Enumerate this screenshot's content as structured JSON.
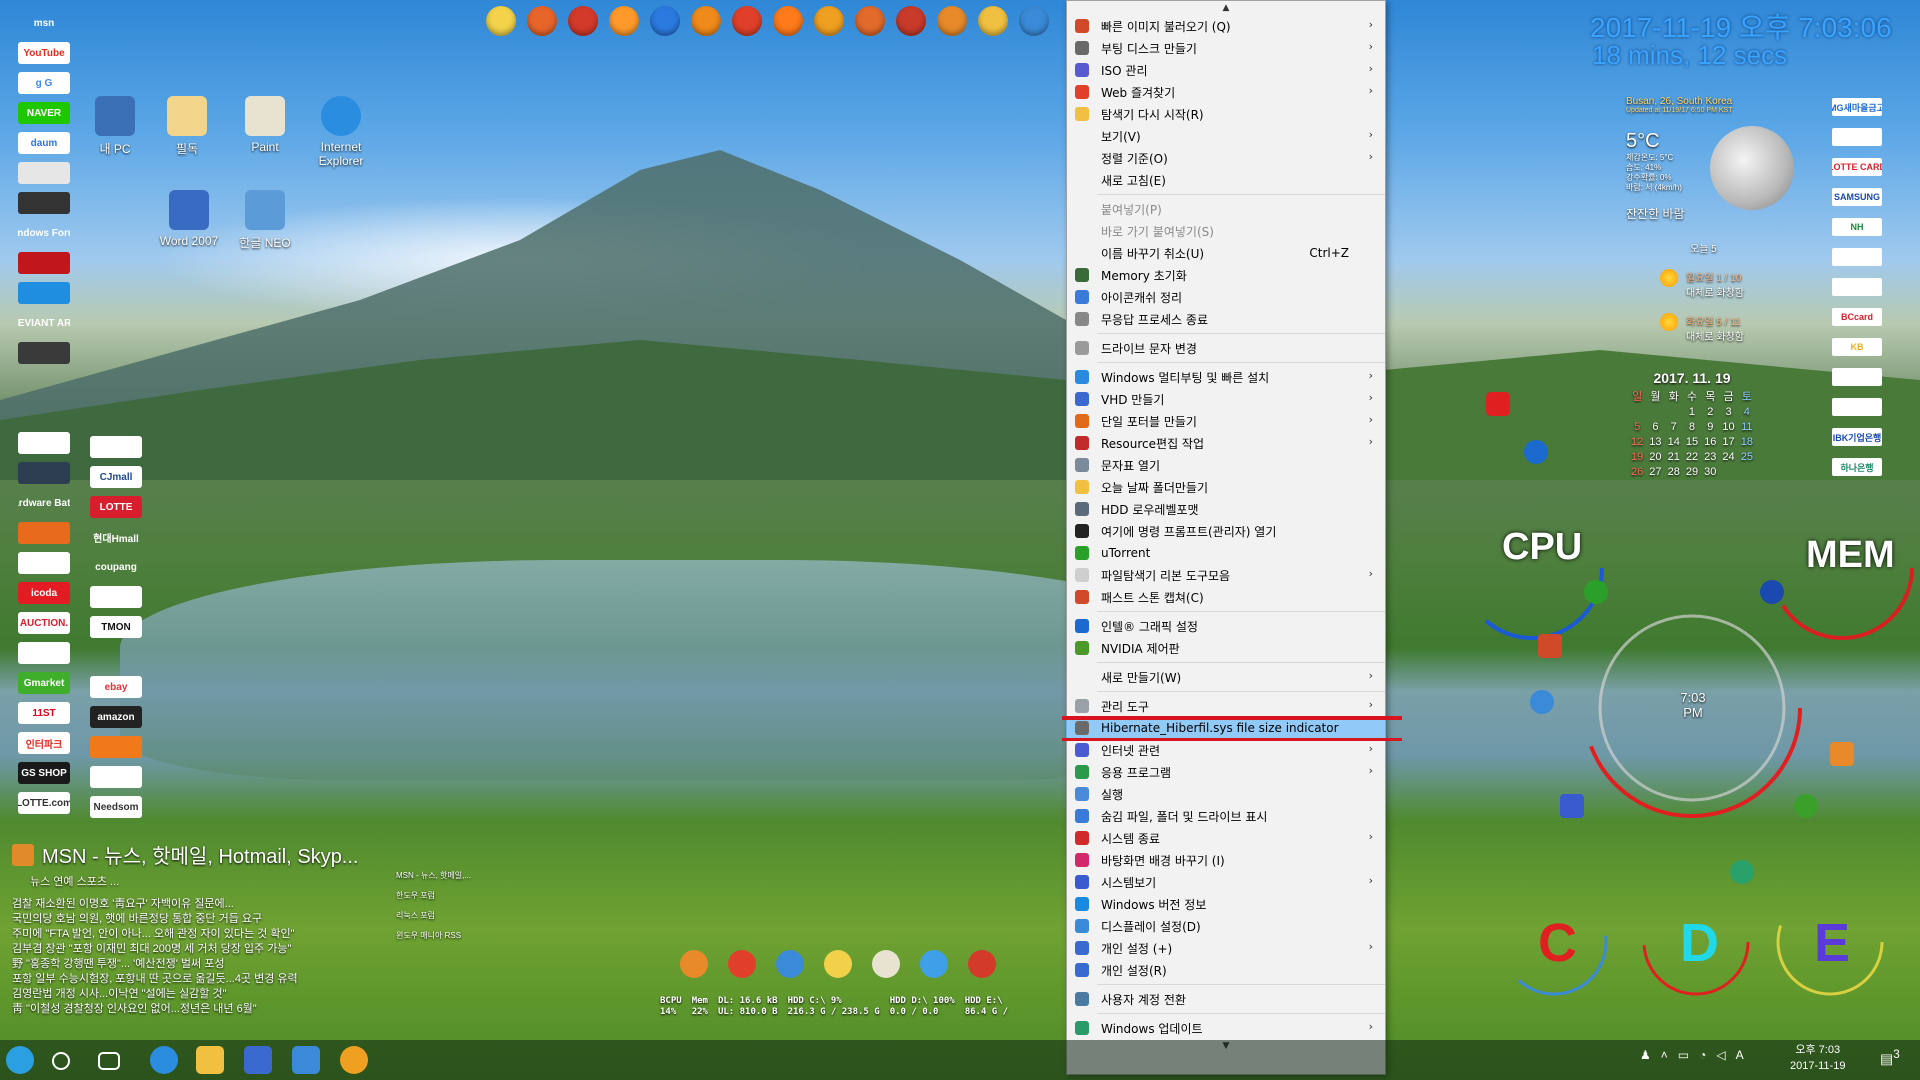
{
  "desktop": {
    "icons": [
      {
        "label": "내 PC",
        "color": "#3b6fb6"
      },
      {
        "label": "필독",
        "color": "#f2d48a"
      },
      {
        "label": "Paint",
        "color": "#e8e3d0"
      },
      {
        "label": "Internet Explorer",
        "color": "#2a8de0"
      },
      {
        "label": "Word 2007",
        "color": "#3a6bc2"
      },
      {
        "label": "한글 NEO",
        "color": "#5a9bd8"
      }
    ],
    "left_links": [
      {
        "label": "msn",
        "bg": "transparent",
        "fg": "#ffffff"
      },
      {
        "label": "YouTube",
        "bg": "#ffffff",
        "fg": "#e02b20"
      },
      {
        "label": "g G",
        "bg": "#ffffff",
        "fg": "#4285f4"
      },
      {
        "label": "NAVER",
        "bg": "#1ec800",
        "fg": "#ffffff"
      },
      {
        "label": "daum",
        "bg": "#ffffff",
        "fg": "#2d77e3"
      },
      {
        "label": "",
        "bg": "#e6e6e6",
        "fg": "#333333"
      },
      {
        "label": "",
        "bg": "#333333",
        "fg": "#ffffff"
      },
      {
        "label": "Windows Forum",
        "bg": "transparent",
        "fg": "#ffffff"
      },
      {
        "label": "",
        "bg": "#c0161c",
        "fg": "#ffffff"
      },
      {
        "label": "",
        "bg": "#1f8ee0",
        "fg": "#ffffff"
      },
      {
        "label": "DEVIANT ART",
        "bg": "transparent",
        "fg": "#ffffff"
      },
      {
        "label": "",
        "bg": "#3a3a3a",
        "fg": "#ffffff"
      },
      {
        "label": "",
        "bg": "transparent",
        "fg": "#ffffff"
      },
      {
        "label": "",
        "bg": "transparent",
        "fg": "#ffffff"
      },
      {
        "label": "",
        "bg": "#ffffff",
        "fg": "#c81e1e"
      },
      {
        "label": "",
        "bg": "#2c3e50",
        "fg": "#ffffff"
      },
      {
        "label": "Hardware Battle",
        "bg": "transparent",
        "fg": "#ffffff"
      },
      {
        "label": "",
        "bg": "#e86a1c",
        "fg": "#ffffff"
      },
      {
        "label": "",
        "bg": "#ffffff",
        "fg": "#333333"
      },
      {
        "label": "icoda",
        "bg": "#e31b23",
        "fg": "#ffffff"
      },
      {
        "label": "AUCTION.",
        "bg": "#ffffff",
        "fg": "#d81e2c"
      },
      {
        "label": "",
        "bg": "#ffffff",
        "fg": "#2d77e3"
      },
      {
        "label": "Gmarket",
        "bg": "#3fae2a",
        "fg": "#ffffff"
      },
      {
        "label": "11ST",
        "bg": "#ffffff",
        "fg": "#e3001b"
      },
      {
        "label": "인터파크",
        "bg": "#ffffff",
        "fg": "#e02b20"
      },
      {
        "label": "GS SHOP",
        "bg": "#1a1a1a",
        "fg": "#ffffff"
      },
      {
        "label": "LOTTE.com",
        "bg": "#ffffff",
        "fg": "#333333"
      }
    ],
    "left_links2": [
      {
        "label": "",
        "bg": "#ffffff",
        "fg": "#d81e2c"
      },
      {
        "label": "CJmall",
        "bg": "#ffffff",
        "fg": "#1f4a8a"
      },
      {
        "label": "LOTTE",
        "bg": "#d81e2c",
        "fg": "#ffffff"
      },
      {
        "label": "현대Hmall",
        "bg": "transparent",
        "fg": "#ffffff"
      },
      {
        "label": "coupang",
        "bg": "transparent",
        "fg": "#ffffff"
      },
      {
        "label": "",
        "bg": "#ffffff",
        "fg": "#2d77e3"
      },
      {
        "label": "TMON",
        "bg": "#ffffff",
        "fg": "#111111"
      },
      {
        "label": "",
        "bg": "transparent",
        "fg": "#ffffff"
      },
      {
        "label": "ebay",
        "bg": "#ffffff",
        "fg": "#e53238"
      },
      {
        "label": "amazon",
        "bg": "#222222",
        "fg": "#ffffff"
      },
      {
        "label": "",
        "bg": "#f07a1a",
        "fg": "#ffffff"
      },
      {
        "label": "",
        "bg": "#ffffff",
        "fg": "#e86a1c"
      },
      {
        "label": "Needsom",
        "bg": "#ffffff",
        "fg": "#333333"
      }
    ]
  },
  "quicklaunch_colors": [
    "#f4d34a",
    "#e8652a",
    "#d43a2a",
    "#ff9a2a",
    "#2a7ae0",
    "#f08a1a",
    "#e0402a",
    "#ff7a1a",
    "#f0a020",
    "#e26a2a",
    "#c83a2a",
    "#e88a2a",
    "#f0c040",
    "#3a8ad8"
  ],
  "msn": {
    "title": "MSN - 뉴스, 핫메일, Hotmail, Skyp...",
    "subtitle": "뉴스 연예 스포츠 ...",
    "news": [
      "검찰 재소환된 이명호 '靑요구' 자백이유 질문에...",
      "국민의당 호남 의원, 햇에 바른정당 통합 중단 거듭 요구",
      "주미에 \"FTA 발언, 안이 아나... 오해 관정 자이 있다는 것 확인\"",
      "김부겸 장관 \"포항 이재민 최대 200명 세 거처 당장 입주 가능\"",
      "野 \"홍종학 강행땐 투쟁\"... '예산전쟁' 벌써 포성",
      "포항 일부 수능시험장, 포항내 딴 곳으로 옮길듯...4곳 변경 유력",
      "김영란법 개정 시사...이낙연 \"설에는 실감할 것\"",
      "靑 \"이철성 경찰청장 인사요인 없어...정년은 내년 6월\""
    ],
    "side_items": [
      "MSN - 뉴스, 핫메일,...",
      "한도우 포럼",
      "리눅스 포럼",
      "윈도우 매니아 RSS"
    ]
  },
  "dock_colors": [
    "#e88a2a",
    "#e0402a",
    "#3a8ad8",
    "#f2d04a",
    "#e8e3d0",
    "#3fa0e8",
    "#d43a2a"
  ],
  "stats": [
    {
      "label": "BCPU",
      "value": "14%"
    },
    {
      "label": "Mem",
      "value": "22%"
    },
    {
      "label": "DL: 16.6 kB",
      "value": "UL: 810.0 B"
    },
    {
      "label": "HDD C:\\ 9%",
      "value": "216.3 G / 238.5 G"
    },
    {
      "label": "HDD D:\\ 100%",
      "value": "0.0 / 0.0"
    },
    {
      "label": "HDD E:\\",
      "value": "86.4 G /"
    }
  ],
  "context_menu": {
    "items": [
      {
        "label": "빠른 이미지 불러오기 (Q)",
        "submenu": true,
        "icon": "#d04a2a"
      },
      {
        "label": "부팅 디스크 만들기",
        "submenu": true,
        "icon": "#6a6a6a"
      },
      {
        "label": "ISO 관리",
        "submenu": true,
        "icon": "#5a5ad0"
      },
      {
        "label": "Web 즐겨찾기",
        "submenu": true,
        "icon": "#e0402a"
      },
      {
        "label": "탐색기 다시 시작(R)",
        "submenu": false,
        "icon": "#f2c040"
      },
      {
        "label": "보기(V)",
        "submenu": true,
        "icon": ""
      },
      {
        "label": "정렬 기준(O)",
        "submenu": true,
        "icon": ""
      },
      {
        "label": "새로 고침(E)",
        "submenu": false,
        "icon": ""
      },
      {
        "sep": true
      },
      {
        "label": "붙여넣기(P)",
        "disabled": true,
        "icon": ""
      },
      {
        "label": "바로 가기 붙여넣기(S)",
        "disabled": true,
        "icon": ""
      },
      {
        "label": "이름 바꾸기 취소(U)",
        "shortcut": "Ctrl+Z",
        "icon": ""
      },
      {
        "label": "Memory 초기화",
        "submenu": false,
        "icon": "#3a6a3a"
      },
      {
        "label": "아이콘캐쉬 정리",
        "submenu": false,
        "icon": "#3a7ad8"
      },
      {
        "label": "무응답 프로세스 종료",
        "submenu": false,
        "icon": "#888888"
      },
      {
        "sep": true
      },
      {
        "label": "드라이브 문자 변경",
        "submenu": false,
        "icon": "#9a9a9a"
      },
      {
        "sep": true
      },
      {
        "label": "Windows 멀티부팅 및 빠른 설치",
        "submenu": true,
        "icon": "#2a8ae0"
      },
      {
        "label": "VHD 만들기",
        "submenu": true,
        "icon": "#3a6ad0"
      },
      {
        "label": "단일 포터블 만들기",
        "submenu": true,
        "icon": "#e06a1a"
      },
      {
        "label": "Resource편집 작업",
        "submenu": true,
        "icon": "#c02a2a"
      },
      {
        "label": "문자표 열기",
        "submenu": false,
        "icon": "#7a8a9a"
      },
      {
        "label": "오늘 날짜 폴더만들기",
        "submenu": false,
        "icon": "#f2c040"
      },
      {
        "label": "HDD 로우레벨포맷",
        "submenu": false,
        "icon": "#5a6a7a"
      },
      {
        "label": "여기에 명령 프롬프트(관리자) 열기",
        "submenu": false,
        "icon": "#222222"
      },
      {
        "label": "uTorrent",
        "submenu": false,
        "icon": "#2aa02a"
      },
      {
        "label": "파일탐색기 리본 도구모음",
        "submenu": true,
        "icon": "#cfcfcf"
      },
      {
        "label": "패스트 스톤 캡쳐(C)",
        "submenu": false,
        "icon": "#d04a2a"
      },
      {
        "sep": true
      },
      {
        "label": "인텔® 그래픽 설정",
        "submenu": false,
        "icon": "#1a6ad0"
      },
      {
        "label": "NVIDIA 제어판",
        "submenu": false,
        "icon": "#4a9a2a"
      },
      {
        "sep": true
      },
      {
        "label": "새로 만들기(W)",
        "submenu": true,
        "icon": ""
      },
      {
        "sep": true
      },
      {
        "label": "관리 도구",
        "submenu": true,
        "icon": "#9aa0a8"
      },
      {
        "label": "Hibernate_Hiberfil.sys file size indicator",
        "submenu": false,
        "icon": "#6a6a6a",
        "highlight": true
      },
      {
        "label": "인터넷 관련",
        "submenu": true,
        "icon": "#4a5ad0"
      },
      {
        "label": "응용 프로그램",
        "submenu": true,
        "icon": "#2a9a4a"
      },
      {
        "label": "실행",
        "submenu": false,
        "icon": "#4a8ad8"
      },
      {
        "label": "숨김 파일, 폴더 및 드라이브 표시",
        "submenu": false,
        "icon": "#3a7ad8"
      },
      {
        "label": "시스템 종료",
        "submenu": true,
        "icon": "#d02a2a"
      },
      {
        "label": "바탕화면 배경 바꾸기 (I)",
        "submenu": false,
        "icon": "#d02a6a"
      },
      {
        "label": "시스템보기",
        "submenu": true,
        "icon": "#3a5ad0"
      },
      {
        "label": "Windows 버전 정보",
        "submenu": false,
        "icon": "#1a8ae0"
      },
      {
        "label": "디스플레이 설정(D)",
        "submenu": false,
        "icon": "#3a8ad8"
      },
      {
        "label": "개인 설정 (+)",
        "submenu": true,
        "icon": "#3a6ad0"
      },
      {
        "label": "개인 설정(R)",
        "submenu": false,
        "icon": "#3a6ad0"
      },
      {
        "sep": true
      },
      {
        "label": "사용자 계정 전환",
        "submenu": false,
        "icon": "#4a7aa0"
      },
      {
        "sep": true
      },
      {
        "label": "Windows 업데이트",
        "submenu": true,
        "icon": "#2a9a6a"
      }
    ]
  },
  "clock": {
    "line1": "2017-11-19 오후 7:03:06",
    "line2": "18 mins, 12 secs"
  },
  "weather": {
    "location": "Busan, 26, South Korea",
    "updated": "Updated at 11/19/17 6:50 PM KST",
    "temp": "5°C",
    "details": [
      "체감온도: 5°C",
      "습도: 41%",
      "강수확률: 0%",
      "바람: 서 (4km/h)"
    ],
    "condition": "잔잔한 바람",
    "today": "오늘 5",
    "forecast": [
      {
        "day": "월요일 1 / 10",
        "desc": "대체로 화창함"
      },
      {
        "day": "화요일 5 / 11",
        "desc": "대체로 화창함"
      }
    ]
  },
  "calendar": {
    "title": "2017. 11. 19",
    "headers": [
      "일",
      "월",
      "화",
      "수",
      "목",
      "금",
      "토"
    ],
    "weeks": [
      [
        "",
        "",
        "",
        "1",
        "2",
        "3",
        "4"
      ],
      [
        "5",
        "6",
        "7",
        "8",
        "9",
        "10",
        "11"
      ],
      [
        "12",
        "13",
        "14",
        "15",
        "16",
        "17",
        "18"
      ],
      [
        "19",
        "20",
        "21",
        "22",
        "23",
        "24",
        "25"
      ],
      [
        "26",
        "27",
        "28",
        "29",
        "30",
        "",
        ""
      ]
    ]
  },
  "banks": [
    {
      "label": "MG새마을금고",
      "fg": "#1a6ad0"
    },
    {
      "label": "",
      "fg": "#f2a020"
    },
    {
      "label": "LOTTE CARD",
      "fg": "#d81e2c"
    },
    {
      "label": "SAMSUNG",
      "fg": "#1a4ab0"
    },
    {
      "label": "NH",
      "fg": "#1a8a3a"
    },
    {
      "label": "",
      "fg": "#1a4ab0"
    },
    {
      "label": "",
      "fg": "#333333"
    },
    {
      "label": "BCcard",
      "fg": "#d81e2c"
    },
    {
      "label": "KB",
      "fg": "#f2b020"
    },
    {
      "label": "",
      "fg": "#1a4ab0"
    },
    {
      "label": "",
      "fg": "#1a6ad0"
    },
    {
      "label": "IBK기업은행",
      "fg": "#1a4ab0"
    },
    {
      "label": "하나은행",
      "fg": "#1a8a6a"
    }
  ],
  "gauges": {
    "cpu": "CPU",
    "mem": "MEM",
    "time": "7:03",
    "ampm": "PM"
  },
  "drives": [
    {
      "label": "C",
      "color": "#e02020"
    },
    {
      "label": "D",
      "color": "#20d8e8"
    },
    {
      "label": "E",
      "color": "#5a3ad8"
    }
  ],
  "taskbar": {
    "time": "오후 7:03",
    "date": "2017-11-19",
    "lang": "A",
    "notification_count": "3"
  }
}
